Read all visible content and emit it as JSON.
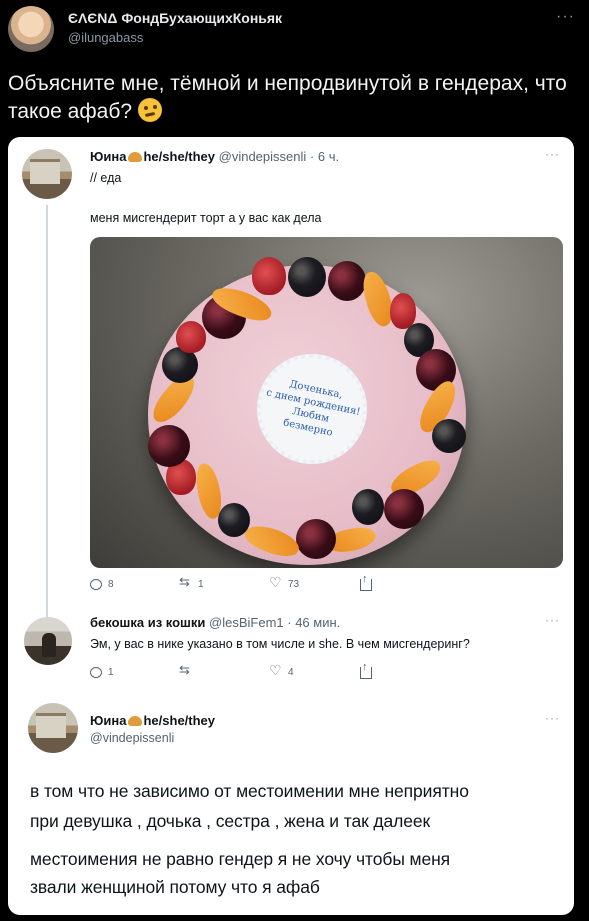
{
  "outer_tweet": {
    "author_name": "ЄΛЄΝΔ ФондБухающихКоньяк",
    "handle": "@ilungabass",
    "more_label": "···",
    "text": "Объясните мне, тёмной и непродвинутой в гендерах, что такое афаб?",
    "emoji": "thinking-face-emoji"
  },
  "embedded": {
    "tweet1": {
      "author_name": "Юина",
      "pronouns": "he/she/they",
      "handle": "@vindepissenli",
      "time": "· 6 ч.",
      "tag": "// еда",
      "text": "меня мисгендерит торт а у вас как дела",
      "photo_caption": "Доченька,\nс днем рождения!\nЛюбим\nбезмерно",
      "stats": {
        "replies": "8",
        "retweets": "1",
        "likes": "73"
      }
    },
    "tweet2": {
      "author_name": "бекошка из кошки",
      "handle": "@lesBiFem1",
      "time": "· 46 мин.",
      "text": "Эм, у вас в нике указано в том числе и she. В чем мисгендеринг?",
      "stats": {
        "replies": "1",
        "retweets": "",
        "likes": "4"
      }
    },
    "tweet3": {
      "author_name": "Юина",
      "pronouns": "he/she/they",
      "handle": "@vindepissenli",
      "line1": "в том что не зависимо от местоимении мне неприятно",
      "line2": "при девушка , дочька , сестра , жена и так далеек",
      "line3": "местоимения не равно гендер я не хочу чтобы меня",
      "line4": "звали женщиной потому что я афаб"
    },
    "more_label": "···"
  },
  "colors": {
    "background": "#000000",
    "card": "#ffffff",
    "secondary_text": "#536471",
    "handle_dark": "#8b98a5"
  }
}
